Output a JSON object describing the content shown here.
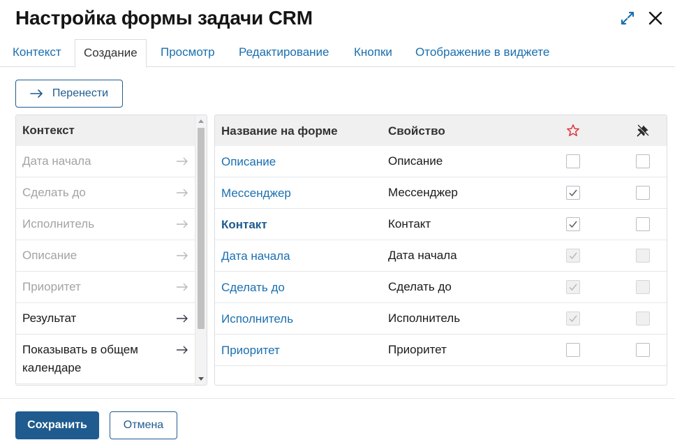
{
  "header": {
    "title": "Настройка формы задачи CRM",
    "icons": {
      "expand": "expand-arrows-icon",
      "close": "close-icon"
    },
    "accent_color": "#1a6fb0"
  },
  "tabs": [
    {
      "label": "Контекст",
      "active": false
    },
    {
      "label": "Создание",
      "active": true
    },
    {
      "label": "Просмотр",
      "active": false
    },
    {
      "label": "Редактирование",
      "active": false
    },
    {
      "label": "Кнопки",
      "active": false
    },
    {
      "label": "Отображение в виджете",
      "active": false
    }
  ],
  "toolbar": {
    "move_label": "Перенести",
    "move_icon": "arrow-right-icon"
  },
  "context_list": {
    "header": "Контекст",
    "items": [
      {
        "label": "Дата начала",
        "disabled": true
      },
      {
        "label": "Сделать до",
        "disabled": true
      },
      {
        "label": "Исполнитель",
        "disabled": true
      },
      {
        "label": "Описание",
        "disabled": true
      },
      {
        "label": "Приоритет",
        "disabled": true
      },
      {
        "label": "Результат",
        "disabled": false
      },
      {
        "label": "Показывать в общем календаре",
        "disabled": false
      }
    ]
  },
  "form_table": {
    "columns": [
      "Название на форме",
      "Свойство"
    ],
    "column_icons": [
      "star-icon",
      "pin-icon"
    ],
    "star_color": "#e0333a",
    "rows": [
      {
        "name": "Описание",
        "property": "Описание",
        "required": false,
        "required_disabled": false,
        "pinned": false,
        "pinned_disabled": false,
        "bold": false
      },
      {
        "name": "Мессенджер",
        "property": "Мессенджер",
        "required": true,
        "required_disabled": false,
        "pinned": false,
        "pinned_disabled": false,
        "bold": false
      },
      {
        "name": "Контакт",
        "property": "Контакт",
        "required": true,
        "required_disabled": false,
        "pinned": false,
        "pinned_disabled": false,
        "bold": true
      },
      {
        "name": "Дата начала",
        "property": "Дата начала",
        "required": true,
        "required_disabled": true,
        "pinned": false,
        "pinned_disabled": true,
        "bold": false
      },
      {
        "name": "Сделать до",
        "property": "Сделать до",
        "required": true,
        "required_disabled": true,
        "pinned": false,
        "pinned_disabled": true,
        "bold": false
      },
      {
        "name": "Исполнитель",
        "property": "Исполнитель",
        "required": true,
        "required_disabled": true,
        "pinned": false,
        "pinned_disabled": true,
        "bold": false
      },
      {
        "name": "Приоритет",
        "property": "Приоритет",
        "required": false,
        "required_disabled": false,
        "pinned": false,
        "pinned_disabled": false,
        "bold": false
      }
    ]
  },
  "footer": {
    "save_label": "Сохранить",
    "cancel_label": "Отмена",
    "primary_color": "#1f5b8f"
  }
}
